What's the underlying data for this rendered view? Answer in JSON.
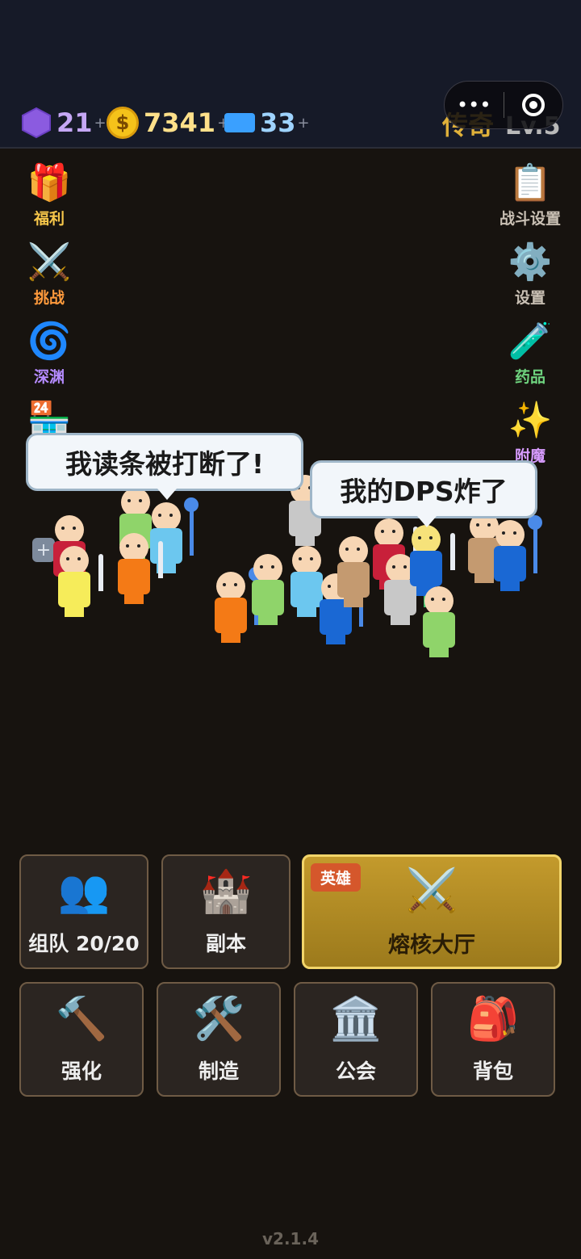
{
  "currencies": {
    "gem": {
      "value": "21",
      "plus": "+",
      "icon": "purple-gem-icon"
    },
    "gold": {
      "value": "7341",
      "plus": "+",
      "symbol": "$",
      "icon": "gold-coin-icon"
    },
    "ticket": {
      "value": "33",
      "plus": "+",
      "icon": "blue-ticket-icon"
    }
  },
  "rank": {
    "tier": "传奇",
    "level": "Lv.5"
  },
  "left_menu": [
    {
      "label": "福利",
      "icon": "gift-icon",
      "glyph": "🎁"
    },
    {
      "label": "挑战",
      "icon": "crossed-swords-icon",
      "glyph": "⚔️"
    },
    {
      "label": "深渊",
      "icon": "vortex-icon",
      "glyph": "🌀"
    },
    {
      "label": "商店",
      "icon": "store-icon",
      "glyph": "🏪"
    }
  ],
  "right_menu": [
    {
      "label": "战斗设置",
      "icon": "clipboard-icon",
      "glyph": "📋"
    },
    {
      "label": "设置",
      "icon": "gear-icon",
      "glyph": "⚙️"
    },
    {
      "label": "药品",
      "icon": "test-tube-icon",
      "glyph": "🧪"
    },
    {
      "label": "附魔",
      "icon": "sparkles-icon",
      "glyph": "✨"
    }
  ],
  "bubbles": {
    "left": "我读条被打断了!",
    "right": "我的DPS炸了"
  },
  "main_buttons": {
    "team": {
      "label": "组队 20/20",
      "icon": "team-icon",
      "glyph": "👥"
    },
    "dungeon": {
      "label": "副本",
      "icon": "castle-icon",
      "glyph": "🏰"
    },
    "raid": {
      "label": "熔核大厅",
      "badge": "英雄",
      "icon": "crossed-swords-icon",
      "glyph": "⚔️"
    }
  },
  "bottom_buttons": [
    {
      "label": "强化",
      "icon": "hammer-icon",
      "glyph": "🔨"
    },
    {
      "label": "制造",
      "icon": "tools-icon",
      "glyph": "🛠️"
    },
    {
      "label": "公会",
      "icon": "guild-hall-icon",
      "glyph": "🏛️"
    },
    {
      "label": "背包",
      "icon": "backpack-icon",
      "glyph": "🎒"
    }
  ],
  "version": "v2.1.4",
  "colors": {
    "accent_gold": "#c39a2c",
    "topbar": "#161a28",
    "background": "#17130f"
  }
}
